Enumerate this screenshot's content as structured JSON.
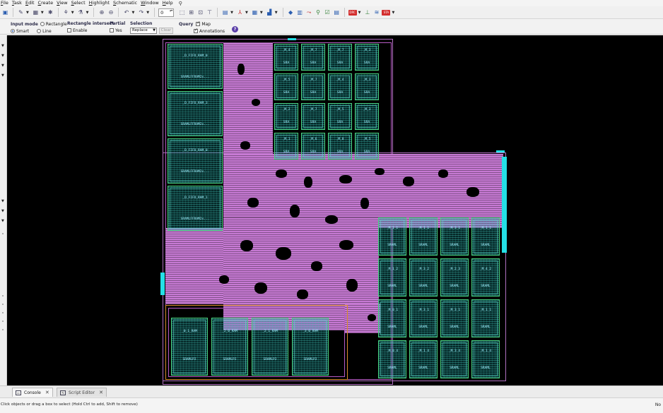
{
  "menu": {
    "items": [
      "File",
      "Task",
      "Edit",
      "Create",
      "View",
      "Select",
      "Highlight",
      "Schematic",
      "Window",
      "Help"
    ]
  },
  "toolbar": {
    "zoom_value": "0",
    "icons": [
      "save-icon",
      "print-icon",
      "pen-icon",
      "ruler-icon",
      "snowflake-icon",
      "network-icon",
      "fork-icon",
      "zoom-in-icon",
      "zoom-out-icon",
      "undo-icon",
      "redo-icon",
      "select-region-icon",
      "hierarchy-icon",
      "cell-icon",
      "flatten-icon",
      "message-icon",
      "tree-icon",
      "grid-icon",
      "chart-icon",
      "route-icon",
      "layers-icon",
      "graph-icon",
      "cross-probe-icon",
      "checklist-icon",
      "drc-icon",
      "stack-icon",
      "report-icon",
      "timing-icon"
    ],
    "badges": [
      "DRC",
      "STA"
    ]
  },
  "options": {
    "input_mode": {
      "title": "Input mode",
      "rectangle": "Rectangle",
      "smart": "Smart",
      "line": "Line"
    },
    "rect_intersect": {
      "title": "Rectangle intersect",
      "enable": "Enable"
    },
    "partial": {
      "title": "Partial",
      "yes": "Yes"
    },
    "selection": {
      "title": "Selection",
      "mode": "Replace",
      "clear": "Clear"
    },
    "query": {
      "title": "Query",
      "map": "Map",
      "annotations": "Annotations"
    }
  },
  "layout": {
    "top_sram": [
      {
        "name": "_M_4",
        "sub": "SRA"
      },
      {
        "name": "_M_7",
        "sub": "SRA"
      },
      {
        "name": "_M_7",
        "sub": "SRA"
      },
      {
        "name": "_M_3",
        "sub": "SRA"
      },
      {
        "name": "_M_5",
        "sub": "SRA"
      },
      {
        "name": "_M_7",
        "sub": "SRA"
      },
      {
        "name": "_M_4",
        "sub": "SRA"
      },
      {
        "name": "_M_3",
        "sub": "SRA"
      },
      {
        "name": "_M_2",
        "sub": "SRA"
      },
      {
        "name": "_M_7",
        "sub": "SRA"
      },
      {
        "name": "_M_5",
        "sub": "SRA"
      },
      {
        "name": "_M_3",
        "sub": "SRA"
      },
      {
        "name": "_M_1",
        "sub": "SRA"
      },
      {
        "name": "_M_6",
        "sub": "SRA"
      },
      {
        "name": "_M_0",
        "sub": "SRA"
      },
      {
        "name": "_M_5",
        "sub": "SRA"
      }
    ],
    "fifo": [
      {
        "name": "_D_FIFO_RAM_0",
        "sub": "SRAMLFFRAM2x..."
      },
      {
        "name": "_D_FIFO_RAM_3",
        "sub": "SRAMLFFRAM2x..."
      },
      {
        "name": "_D_FIFO_RAM_0",
        "sub": "SRAMLFFRAM2x..."
      },
      {
        "name": "_D_FIFO_RAM_1",
        "sub": "SRAMLFFRAM2x..."
      }
    ],
    "right_sram": [
      {
        "name": "_M_1_1",
        "sub": "SRAML"
      },
      {
        "name": "_M_1_1",
        "sub": "SRAML"
      },
      {
        "name": "_M_3_1",
        "sub": "SRAML"
      },
      {
        "name": "_M_1_1",
        "sub": "SRAML"
      },
      {
        "name": "_M_1_2",
        "sub": "SRAML"
      },
      {
        "name": "_M_3_2",
        "sub": "SRAML"
      },
      {
        "name": "_M_2_3",
        "sub": "SRAML"
      },
      {
        "name": "_M_4_2",
        "sub": "SRAML"
      },
      {
        "name": "_M_0_1",
        "sub": "SRAML"
      },
      {
        "name": "_M_3_1",
        "sub": "SRAML"
      },
      {
        "name": "_M_3_1",
        "sub": "SRAML"
      },
      {
        "name": "_M_1_1",
        "sub": "SRAML"
      },
      {
        "name": "_M_0_4",
        "sub": "SRAML"
      },
      {
        "name": "_M_1_4",
        "sub": "SRAML"
      },
      {
        "name": "_M_3_4",
        "sub": "SRAML"
      },
      {
        "name": "_M_1_4",
        "sub": "SRAML"
      }
    ],
    "bottom_sram": [
      {
        "name": "_0_1_RAM",
        "sub": "SRAMLP2"
      },
      {
        "name": "_2_0_RAM",
        "sub": "SRAMLP2"
      },
      {
        "name": "_2_1_RAM",
        "sub": "SRAMLP2"
      },
      {
        "name": "_3_0_RAM",
        "sub": "SRAMLP2"
      }
    ]
  },
  "tabs": {
    "console": "Console",
    "script_editor": "Script Editor"
  },
  "status": {
    "message": "Click objects or drag a box to select (Hold Ctrl to add, Shift to remove)",
    "right": "No"
  }
}
